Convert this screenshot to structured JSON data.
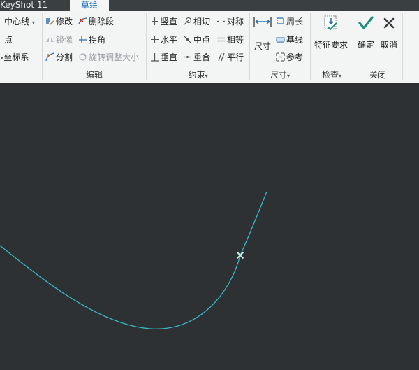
{
  "tabs": {
    "left_label": "KeyShot 11",
    "active_label": "草绘"
  },
  "ribbon": {
    "datum": {
      "centerline": "中心线",
      "point": "点",
      "coord": "坐标系"
    },
    "edit": {
      "label": "编辑",
      "modify": "修改",
      "delete_segment": "删除段",
      "mirror": "镜像",
      "corner": "拐角",
      "divide": "分割",
      "rotate_resize": "旋转调整大小"
    },
    "constrain": {
      "label": "约束",
      "vertical": "竖直",
      "tangent": "相切",
      "symmetric": "对称",
      "horizontal": "水平",
      "midpoint": "中点",
      "equal": "相等",
      "perpendicular": "垂直",
      "coincident": "重合",
      "parallel": "平行"
    },
    "dimension": {
      "label": "尺寸",
      "dimension": "尺寸",
      "perimeter": "周长",
      "baseline": "基线",
      "reference": "参考"
    },
    "inspect": {
      "label": "检查",
      "feature_requirements": "特征要求"
    },
    "close": {
      "label": "关闭",
      "ok": "确定",
      "cancel": "取消"
    }
  },
  "colors": {
    "canvas_bg": "#2d3133",
    "curve": "#3ab7c4",
    "accent_check": "#1e8a7a"
  }
}
